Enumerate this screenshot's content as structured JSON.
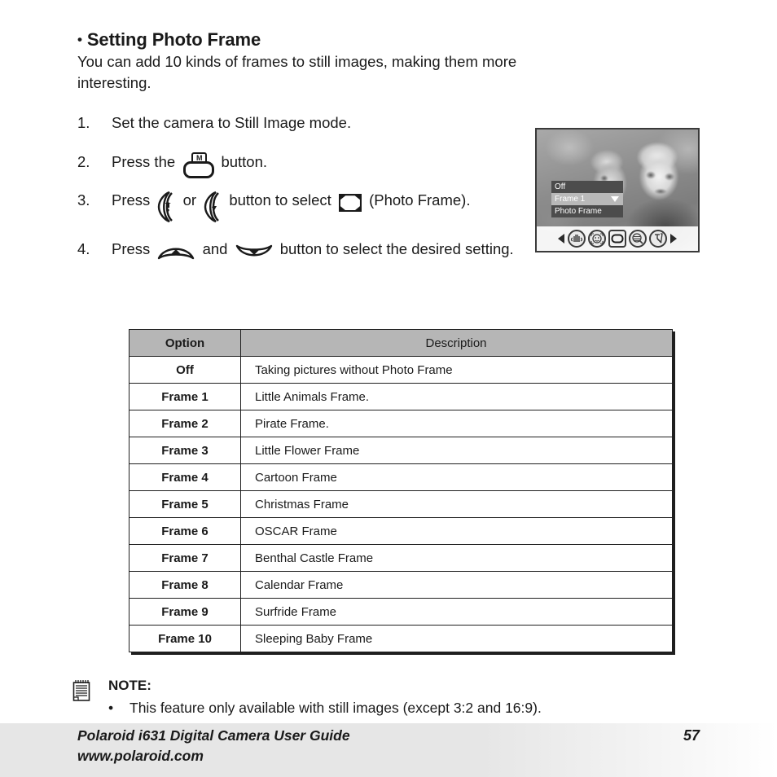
{
  "heading": {
    "bullet": "•",
    "title": "Setting Photo Frame"
  },
  "intro": {
    "line1": "You can add 10 kinds of frames to still images, making them more",
    "line2": "interesting."
  },
  "steps": [
    {
      "num": "1.",
      "text_before": "Set the camera to Still Image mode.",
      "text_mid": "",
      "text_after": ""
    },
    {
      "num": "2.",
      "text_before": "Press the",
      "text_mid": "",
      "text_after": "button."
    },
    {
      "num": "3.",
      "text_before": "Press",
      "text_mid": "or",
      "text_after": "button to select",
      "text_tail": "(Photo Frame)."
    },
    {
      "num": "4.",
      "text_before": "Press",
      "text_mid": "and",
      "text_after": "button to select the desired setting."
    }
  ],
  "lcd": {
    "osd": [
      {
        "label": "Off",
        "selected": false
      },
      {
        "label": "Frame 1",
        "selected": true
      },
      {
        "label": "Photo Frame",
        "selected": false
      }
    ],
    "toolbar_icons": [
      "stabilizer-icon",
      "face-detect-icon",
      "photo-frame-icon",
      "sharpness-icon",
      "effect-icon"
    ],
    "nav_left": "prev-arrow-icon",
    "nav_right": "next-arrow-icon"
  },
  "table": {
    "headers": [
      "Option",
      "Description"
    ],
    "rows": [
      [
        "Off",
        "Taking pictures without Photo Frame"
      ],
      [
        "Frame 1",
        "Little Animals Frame."
      ],
      [
        "Frame 2",
        "Pirate Frame."
      ],
      [
        "Frame 3",
        "Little Flower Frame"
      ],
      [
        "Frame 4",
        "Cartoon Frame"
      ],
      [
        "Frame 5",
        "Christmas Frame"
      ],
      [
        "Frame 6",
        "OSCAR Frame"
      ],
      [
        "Frame 7",
        "Benthal Castle Frame"
      ],
      [
        "Frame 8",
        "Calendar Frame"
      ],
      [
        "Frame 9",
        "Surfride Frame"
      ],
      [
        "Frame 10",
        "Sleeping Baby Frame"
      ]
    ]
  },
  "note": {
    "title": "NOTE:",
    "bullet": "•",
    "text": "This feature only available with still images (except 3:2 and 16:9)."
  },
  "footer": {
    "line1": "Polaroid i631 Digital Camera User Guide",
    "line2": "www.polaroid.com",
    "page": "57"
  },
  "colors": {
    "ink": "#1a1a1a",
    "table_header_bg": "#b6b6b6",
    "footer_bg": "#e6e6e6",
    "osd_bg": "#4c4c4c",
    "osd_selected_bg": "#b9b9b9"
  }
}
